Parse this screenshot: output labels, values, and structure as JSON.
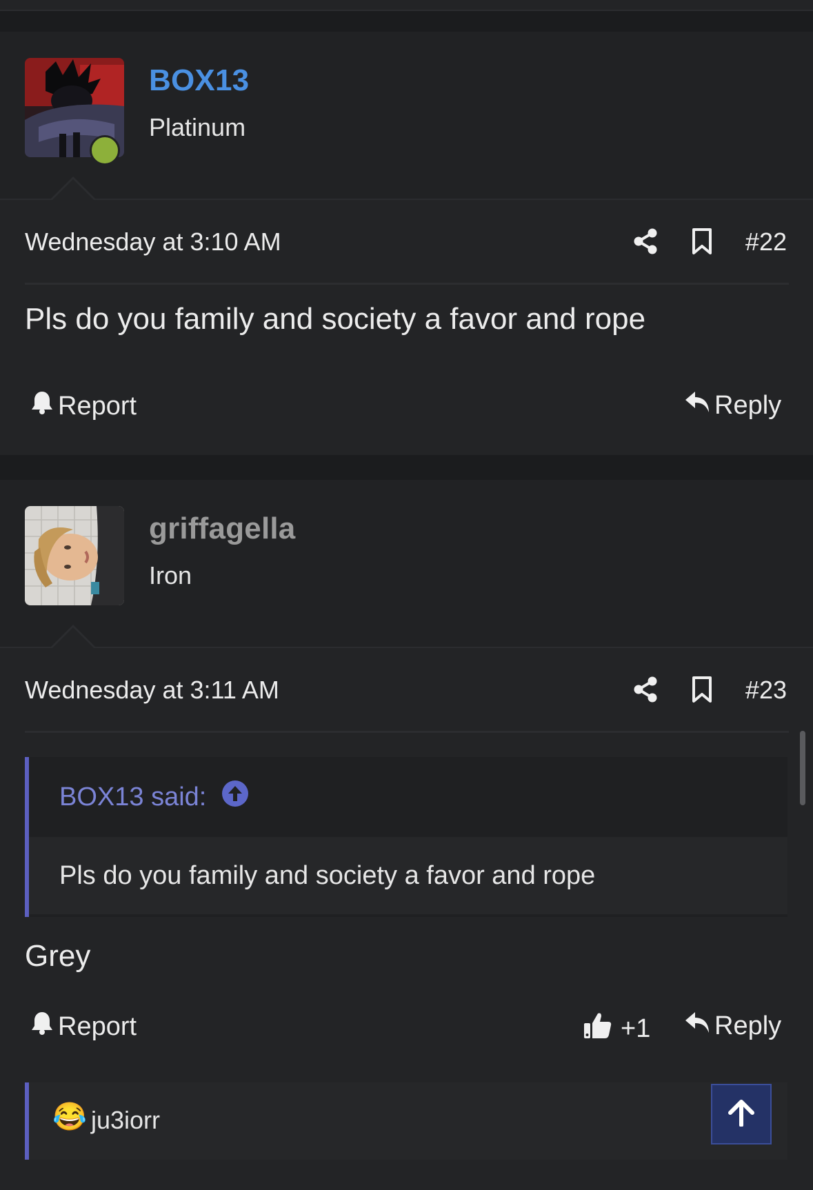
{
  "posts": [
    {
      "username": "BOX13",
      "rank": "Platinum",
      "timestamp": "Wednesday at 3:10 AM",
      "number": "#22",
      "message": "Pls do you family and society a favor and rope",
      "report_label": "Report",
      "reply_label": "Reply",
      "username_color": "#4a90e2",
      "online": true
    },
    {
      "username": "griffagella",
      "rank": "Iron",
      "timestamp": "Wednesday at 3:11 AM",
      "number": "#23",
      "quote": {
        "author_label": "BOX13 said:",
        "text": "Pls do you family and society a favor and rope"
      },
      "message": "Grey",
      "report_label": "Report",
      "like_count": "+1",
      "reply_label": "Reply",
      "username_color": "#9a9a9a",
      "reactions": {
        "emoji": "😂",
        "users": "ju3iorr"
      }
    }
  ],
  "icons": [
    "share-icon",
    "bookmark-icon",
    "bell-icon",
    "reply-icon",
    "thumbs-up-icon",
    "arrow-up-icon"
  ],
  "colors": {
    "background": "#1b1c1e",
    "accent": "#5c5fc0",
    "scroll_top_button": "#243266"
  }
}
